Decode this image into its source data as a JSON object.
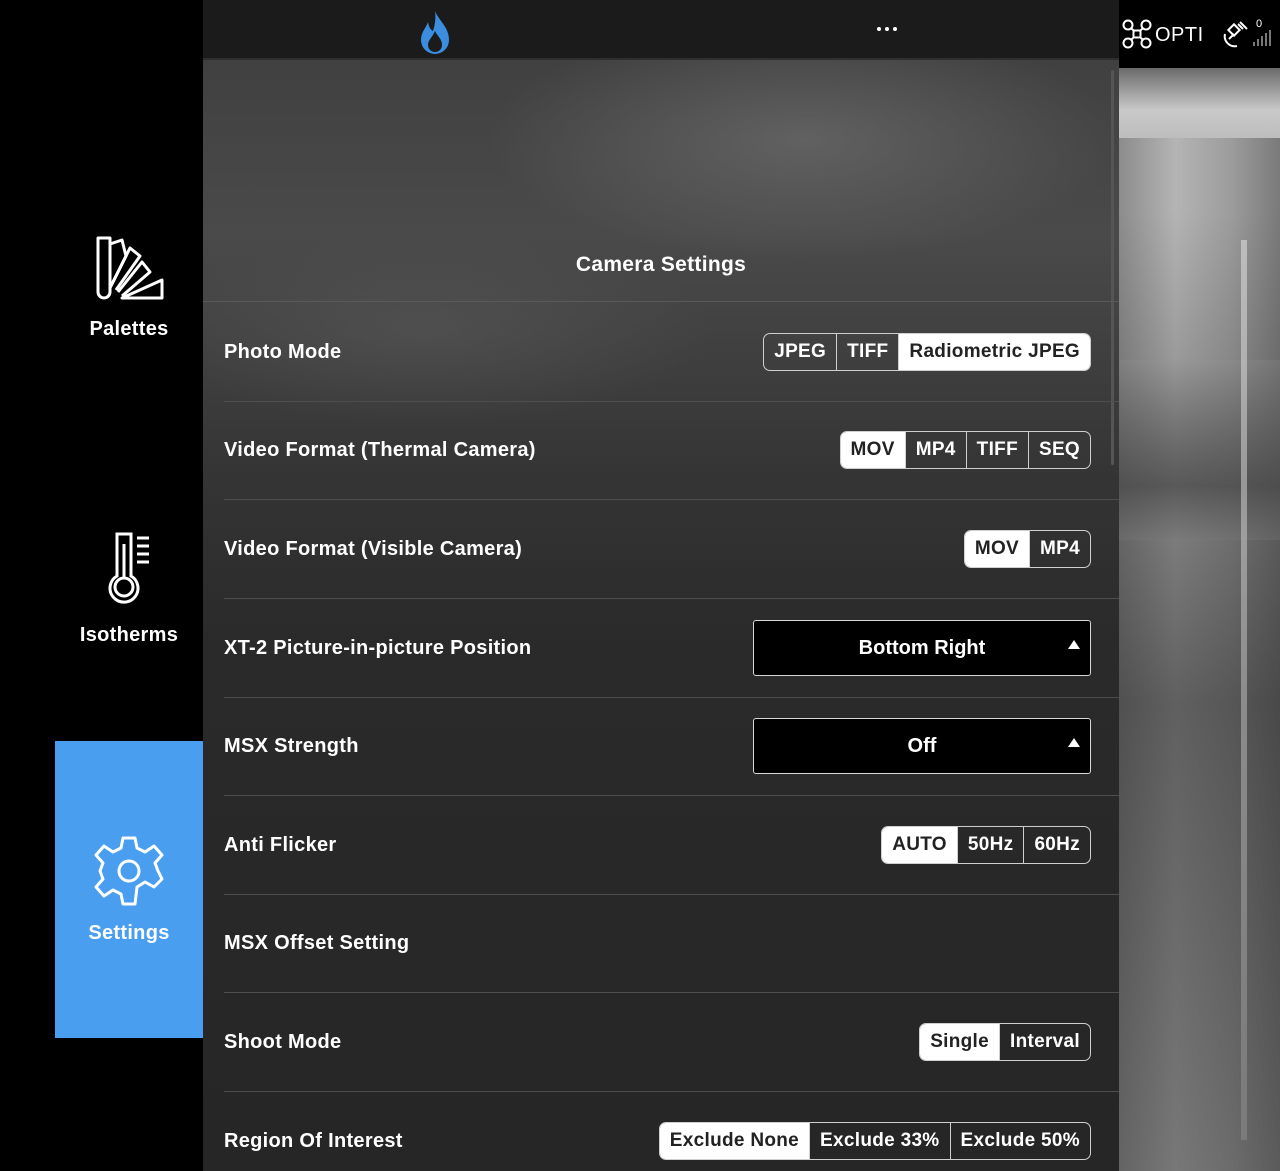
{
  "sidebar": {
    "items": [
      {
        "label": "Palettes",
        "icon": "palettes-icon",
        "active": false
      },
      {
        "label": "Isotherms",
        "icon": "thermometer-icon",
        "active": false
      },
      {
        "label": "Settings",
        "icon": "gear-icon",
        "active": true
      }
    ],
    "active_color": "#4a9ef0"
  },
  "topbar": {
    "logo_icon": "flame-icon",
    "more_icon": "more-dots-icon"
  },
  "panel": {
    "title": "Camera Settings",
    "rows": {
      "photo_mode": {
        "label": "Photo Mode",
        "options": [
          "JPEG",
          "TIFF",
          "Radiometric JPEG"
        ],
        "selected": "Radiometric JPEG"
      },
      "video_thermal": {
        "label": "Video Format (Thermal Camera)",
        "options": [
          "MOV",
          "MP4",
          "TIFF",
          "SEQ"
        ],
        "selected": "MOV"
      },
      "video_visible": {
        "label": "Video Format (Visible Camera)",
        "options": [
          "MOV",
          "MP4"
        ],
        "selected": "MOV"
      },
      "pip_position": {
        "label": "XT-2 Picture-in-picture Position",
        "value": "Bottom Right"
      },
      "msx_strength": {
        "label": "MSX Strength",
        "value": "Off"
      },
      "anti_flicker": {
        "label": "Anti Flicker",
        "options": [
          "AUTO",
          "50Hz",
          "60Hz"
        ],
        "selected": "AUTO"
      },
      "msx_offset": {
        "label": "MSX Offset Setting"
      },
      "shoot_mode": {
        "label": "Shoot Mode",
        "options": [
          "Single",
          "Interval"
        ],
        "selected": "Single"
      },
      "roi": {
        "label": "Region Of Interest",
        "options": [
          "Exclude None",
          "Exclude 33%",
          "Exclude 50%"
        ],
        "selected": "Exclude None"
      }
    }
  },
  "status_bar": {
    "drone_icon": "drone-icon",
    "flight_mode": "OPTI",
    "satellite_icon": "satellite-icon",
    "satellite_count": "0",
    "signal_icon": "signal-bars-icon"
  }
}
